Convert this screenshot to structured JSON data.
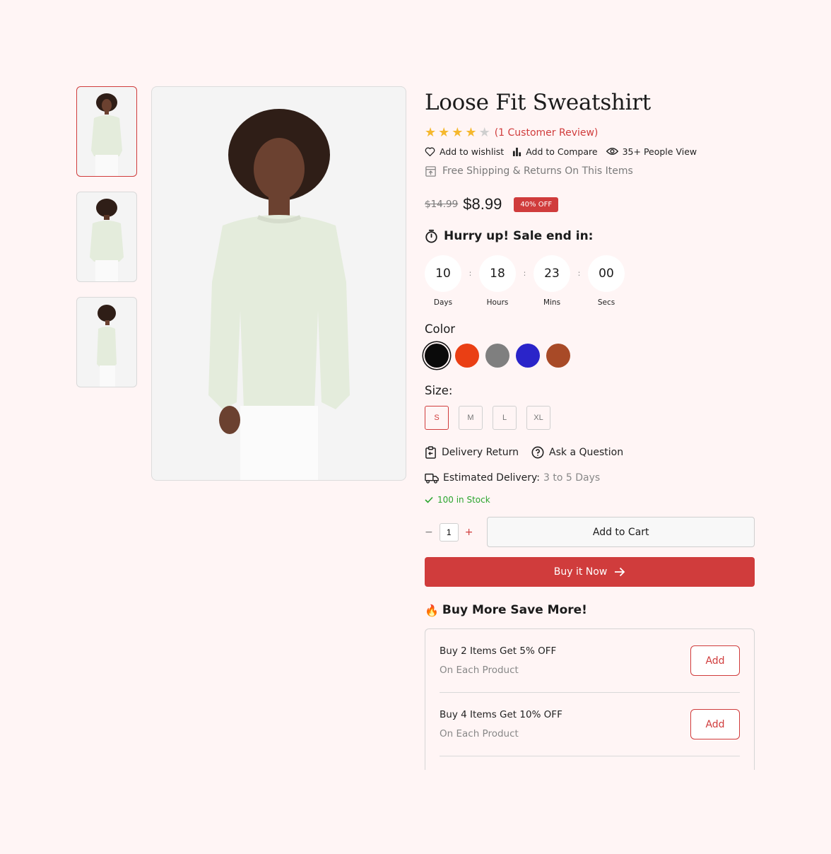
{
  "product": {
    "title": "Loose Fit Sweatshirt",
    "rating": 4,
    "rating_max": 5,
    "review_text": "(1 Customer Review)",
    "old_price": "$14.99",
    "price": "$8.99",
    "discount_badge": "40% OFF"
  },
  "gallery": {
    "thumbnails": [
      "front view",
      "back view",
      "side view"
    ],
    "active_index": 0
  },
  "actions": {
    "wishlist": "Add to wishlist",
    "compare": "Add to Compare",
    "views": "35+ People View"
  },
  "shipping_note": "Free Shipping & Returns On This Items",
  "sale": {
    "heading": "Hurry up! Sale end in:",
    "countdown": [
      {
        "value": "10",
        "label": "Days"
      },
      {
        "value": "18",
        "label": "Hours"
      },
      {
        "value": "23",
        "label": "Mins"
      },
      {
        "value": "00",
        "label": "Secs"
      }
    ],
    "separator": ":"
  },
  "color": {
    "label": "Color",
    "swatches": [
      "#0a0a0a",
      "#ea3f14",
      "#7f7f7f",
      "#2a24c9",
      "#a84a27"
    ],
    "selected_index": 0
  },
  "size": {
    "label": "Size:",
    "options": [
      "S",
      "M",
      "L",
      "XL"
    ],
    "selected": "S"
  },
  "links": {
    "delivery_return": "Delivery Return",
    "ask_question": "Ask a Question"
  },
  "delivery": {
    "label": "Estimated Delivery:",
    "value": "3 to 5 Days"
  },
  "stock": "100 in Stock",
  "cart": {
    "minus": "−",
    "plus": "+",
    "quantity": "1",
    "add_to_cart": "Add to Cart",
    "buy_now": "Buy it Now"
  },
  "bundle": {
    "title": "Buy More Save More!",
    "offers": [
      {
        "title": "Buy 2 Items Get 5% OFF",
        "subtitle": "On Each Product",
        "button": "Add"
      },
      {
        "title": "Buy 4 Items Get 10% OFF",
        "subtitle": "On Each Product",
        "button": "Add"
      }
    ]
  },
  "colors": {
    "accent": "#d03c3c",
    "background": "#fff5f5",
    "star": "#f5b82e",
    "stock_green": "#2ba52e"
  }
}
